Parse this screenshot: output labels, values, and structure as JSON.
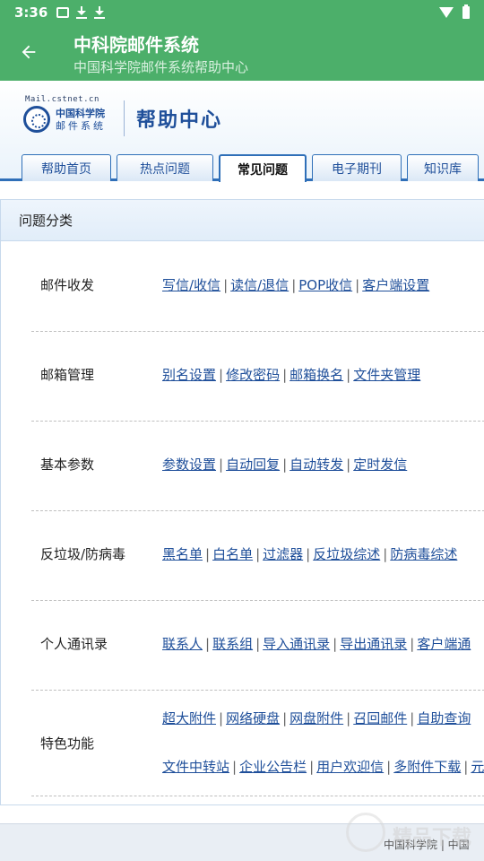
{
  "status_bar": {
    "time": "3:36"
  },
  "app_bar": {
    "title": "中科院邮件系统",
    "subtitle": "中国科学院邮件系统帮助中心"
  },
  "header": {
    "logo_url": "Mail.cstnet.cn",
    "logo_line1": "中国科学院",
    "logo_line2": "邮件系统",
    "title": "帮助中心"
  },
  "tabs": [
    "帮助首页",
    "热点问题",
    "常见问题",
    "电子期刊",
    "知识库"
  ],
  "active_tab": "常见问题",
  "panel": {
    "title": "问题分类",
    "categories": [
      {
        "name": "邮件收发",
        "lines": [
          [
            "写信/收信",
            "读信/退信",
            "POP收信",
            "客户端设置"
          ]
        ]
      },
      {
        "name": "邮箱管理",
        "lines": [
          [
            "别名设置",
            "修改密码",
            "邮箱换名",
            "文件夹管理"
          ]
        ]
      },
      {
        "name": "基本参数",
        "lines": [
          [
            "参数设置",
            "自动回复",
            "自动转发",
            "定时发信"
          ]
        ]
      },
      {
        "name": "反垃圾/防病毒",
        "lines": [
          [
            "黑名单",
            "白名单",
            "过滤器",
            "反垃圾综述",
            "防病毒综述"
          ]
        ]
      },
      {
        "name": "个人通讯录",
        "lines": [
          [
            "联系人",
            "联系组",
            "导入通讯录",
            "导出通讯录",
            "客户端通"
          ]
        ]
      },
      {
        "name": "特色功能",
        "lines": [
          [
            "超大附件",
            "网络硬盘",
            "网盘附件",
            "召回邮件",
            "自助查询"
          ],
          [
            "文件中转站",
            "企业公告栏",
            "用户欢迎信",
            "多附件下载",
            "元"
          ]
        ]
      }
    ]
  },
  "bottom": {
    "text": "中国科学院 | 中国"
  },
  "watermark": {
    "text": "精品下载"
  },
  "colors": {
    "app_bar": "#4caf6a",
    "link": "#1f4f9a",
    "tab_border": "#2f6fb8"
  }
}
